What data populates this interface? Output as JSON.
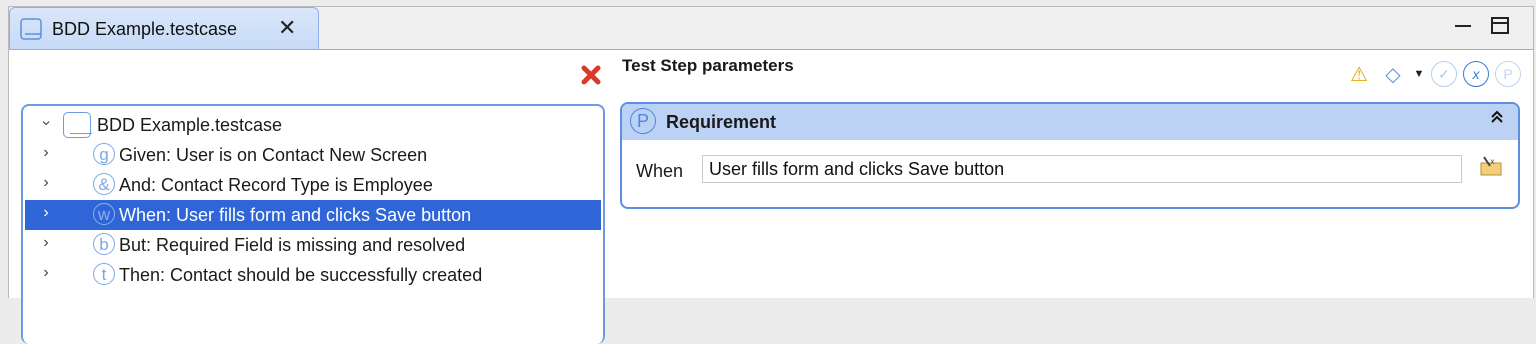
{
  "tab": {
    "title": "BDD Example.testcase",
    "close_glyph": "✕"
  },
  "window_controls": {
    "minimize": "minimize",
    "maximize": "maximize"
  },
  "tree": {
    "root": {
      "label": "BDD Example.testcase",
      "icon": "testcase-icon"
    },
    "items": [
      {
        "glyph": "g",
        "label": "Given: User is on Contact New Screen",
        "selected": false
      },
      {
        "glyph": "&",
        "label": "And: Contact Record Type is Employee",
        "selected": false
      },
      {
        "glyph": "w",
        "label": "When: User fills form and clicks Save button",
        "selected": true
      },
      {
        "glyph": "b",
        "label": "But: Required Field is missing and resolved",
        "selected": false
      },
      {
        "glyph": "t",
        "label": "Then: Contact should be successfully created",
        "selected": false
      }
    ]
  },
  "remove_glyph": "✖",
  "panel": {
    "title": "Test Step parameters",
    "toolbar": [
      "warning-add-icon",
      "tag-icon",
      "dropdown-arrow-icon",
      "check-add-icon",
      "function-icon",
      "parameter-add-icon"
    ],
    "section": {
      "icon_glyph": "P",
      "title": "Requirement",
      "collapse_glyph": "⌃",
      "field_label": "When",
      "field_value": "User fills form and clicks Save button"
    }
  },
  "colors": {
    "selection": "#2f65d6",
    "accent": "#5d8ee0",
    "header_bg": "#bcd2f5"
  }
}
